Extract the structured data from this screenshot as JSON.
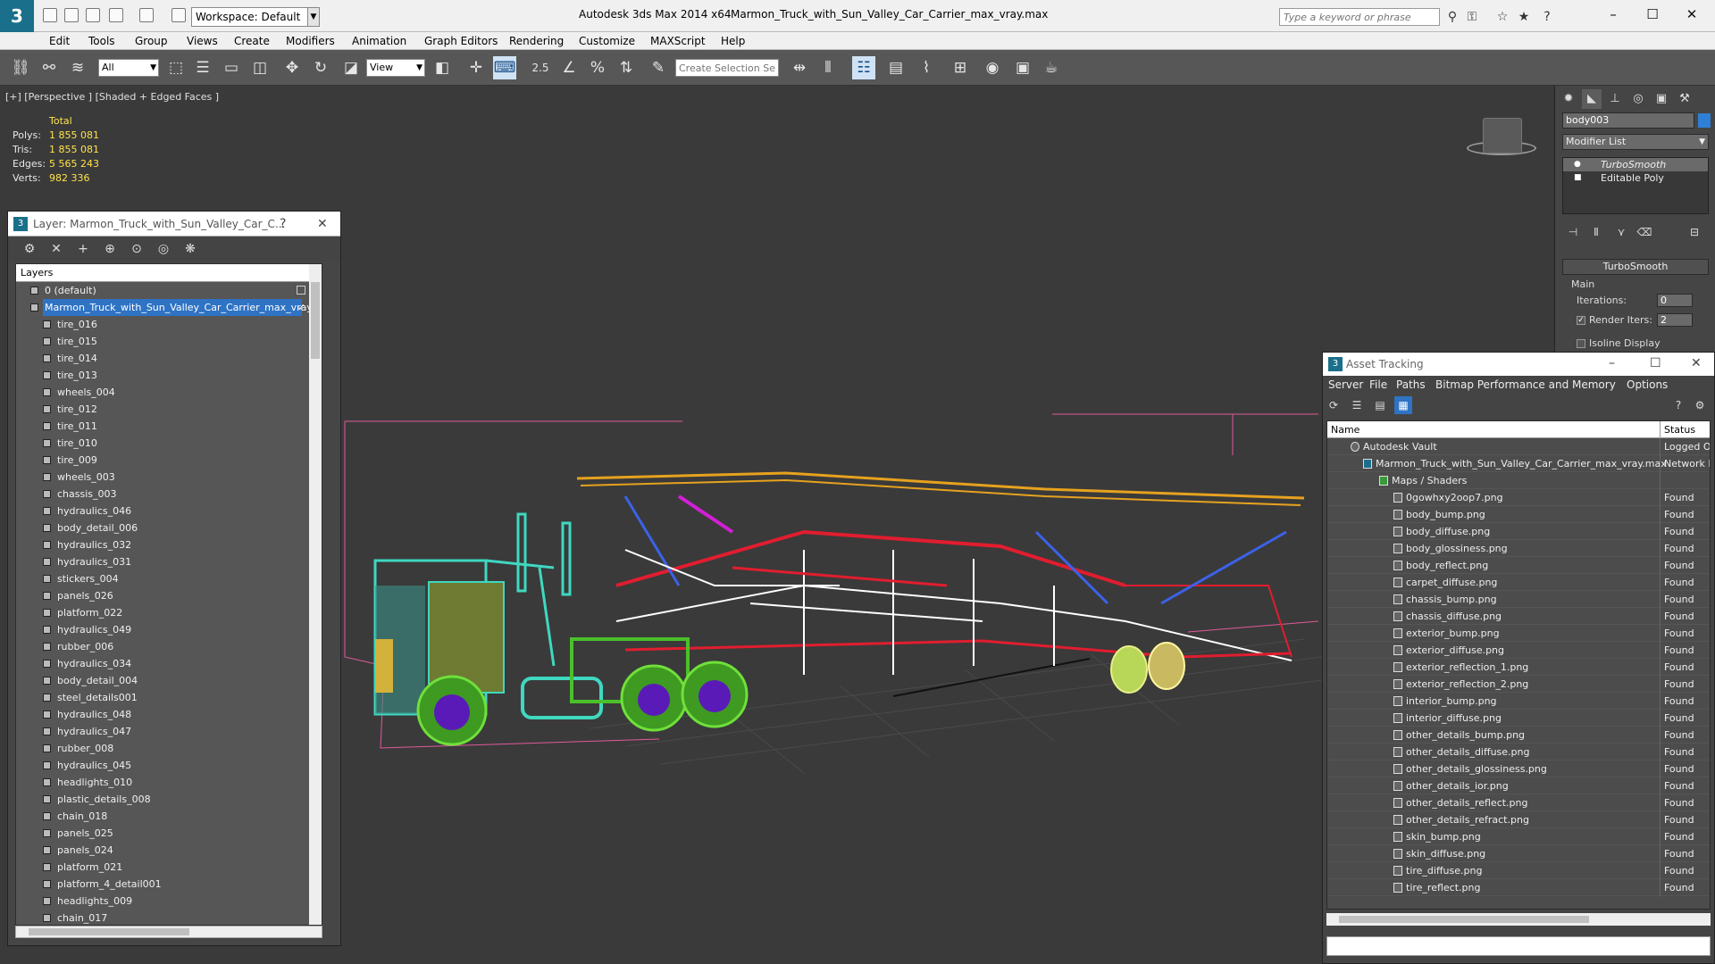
{
  "titlebar": {
    "workspace": "Workspace: Default",
    "app_title": "Autodesk 3ds Max  2014 x64",
    "file_title": "Marmon_Truck_with_Sun_Valley_Car_Carrier_max_vray.max",
    "search_placeholder": "Type a keyword or phrase"
  },
  "menu": [
    "Edit",
    "Tools",
    "Group",
    "Views",
    "Create",
    "Modifiers",
    "Animation",
    "Graph Editors",
    "Rendering",
    "Customize",
    "MAXScript",
    "Help"
  ],
  "toolbar": {
    "selection_filter": "All",
    "ref_coord": "View",
    "snap_label": "2.5",
    "named_selection_placeholder": "Create Selection Se"
  },
  "viewport": {
    "label": "[+] [Perspective ] [Shaded + Edged Faces ]",
    "stats": {
      "header": "Total",
      "rows": [
        {
          "key": "Polys:",
          "value": "1 855 081"
        },
        {
          "key": "Tris:",
          "value": "1 855 081"
        },
        {
          "key": "Edges:",
          "value": "5 565 243"
        },
        {
          "key": "Verts:",
          "value": "982 336"
        }
      ]
    }
  },
  "layer_panel": {
    "title": "Layer: Marmon_Truck_with_Sun_Valley_Car_C...",
    "column": "Layers",
    "root_layers": [
      {
        "label": "0 (default)"
      },
      {
        "label": "Marmon_Truck_with_Sun_Valley_Car_Carrier_max_vray"
      }
    ],
    "objects": [
      "tire_016",
      "tire_015",
      "tire_014",
      "tire_013",
      "wheels_004",
      "tire_012",
      "tire_011",
      "tire_010",
      "tire_009",
      "wheels_003",
      "chassis_003",
      "hydraulics_046",
      "body_detail_006",
      "hydraulics_032",
      "hydraulics_031",
      "stickers_004",
      "panels_026",
      "platform_022",
      "hydraulics_049",
      "rubber_006",
      "hydraulics_034",
      "body_detail_004",
      "steel_details001",
      "hydraulics_048",
      "hydraulics_047",
      "rubber_008",
      "hydraulics_045",
      "headlights_010",
      "plastic_details_008",
      "chain_018",
      "panels_025",
      "panels_024",
      "platform_021",
      "platform_4_detail001",
      "headlights_009",
      "chain_017"
    ]
  },
  "command_panel": {
    "object_name": "body003",
    "object_color": "#2e7fd6",
    "modifier_list": "Modifier List",
    "stack": [
      "TurboSmooth",
      "Editable Poly"
    ],
    "rollout": "TurboSmooth",
    "main_label": "Main",
    "iterations_label": "Iterations:",
    "iterations_value": "0",
    "render_iters_label": "Render Iters:",
    "render_iters_value": "2",
    "isoline_label": "Isoline Display"
  },
  "asset_tracking": {
    "title": "Asset Tracking",
    "menu": [
      "Server",
      "File",
      "Paths",
      "Bitmap Performance and Memory",
      "Options"
    ],
    "col_name": "Name",
    "col_status": "Status",
    "vault": {
      "name": "Autodesk Vault",
      "status": "Logged Out"
    },
    "file": {
      "name": "Marmon_Truck_with_Sun_Valley_Car_Carrier_max_vray.max",
      "status": "Network Path"
    },
    "group": "Maps / Shaders",
    "maps": [
      {
        "name": "0gowhxy2oop7.png",
        "status": "Found"
      },
      {
        "name": "body_bump.png",
        "status": "Found"
      },
      {
        "name": "body_diffuse.png",
        "status": "Found"
      },
      {
        "name": "body_glossiness.png",
        "status": "Found"
      },
      {
        "name": "body_reflect.png",
        "status": "Found"
      },
      {
        "name": "carpet_diffuse.png",
        "status": "Found"
      },
      {
        "name": "chassis_bump.png",
        "status": "Found"
      },
      {
        "name": "chassis_diffuse.png",
        "status": "Found"
      },
      {
        "name": "exterior_bump.png",
        "status": "Found"
      },
      {
        "name": "exterior_diffuse.png",
        "status": "Found"
      },
      {
        "name": "exterior_reflection_1.png",
        "status": "Found"
      },
      {
        "name": "exterior_reflection_2.png",
        "status": "Found"
      },
      {
        "name": "interior_bump.png",
        "status": "Found"
      },
      {
        "name": "interior_diffuse.png",
        "status": "Found"
      },
      {
        "name": "other_details_bump.png",
        "status": "Found"
      },
      {
        "name": "other_details_diffuse.png",
        "status": "Found"
      },
      {
        "name": "other_details_glossiness.png",
        "status": "Found"
      },
      {
        "name": "other_details_ior.png",
        "status": "Found"
      },
      {
        "name": "other_details_reflect.png",
        "status": "Found"
      },
      {
        "name": "other_details_refract.png",
        "status": "Found"
      },
      {
        "name": "skin_bump.png",
        "status": "Found"
      },
      {
        "name": "skin_diffuse.png",
        "status": "Found"
      },
      {
        "name": "tire_diffuse.png",
        "status": "Found"
      },
      {
        "name": "tire_reflect.png",
        "status": "Found"
      }
    ]
  }
}
